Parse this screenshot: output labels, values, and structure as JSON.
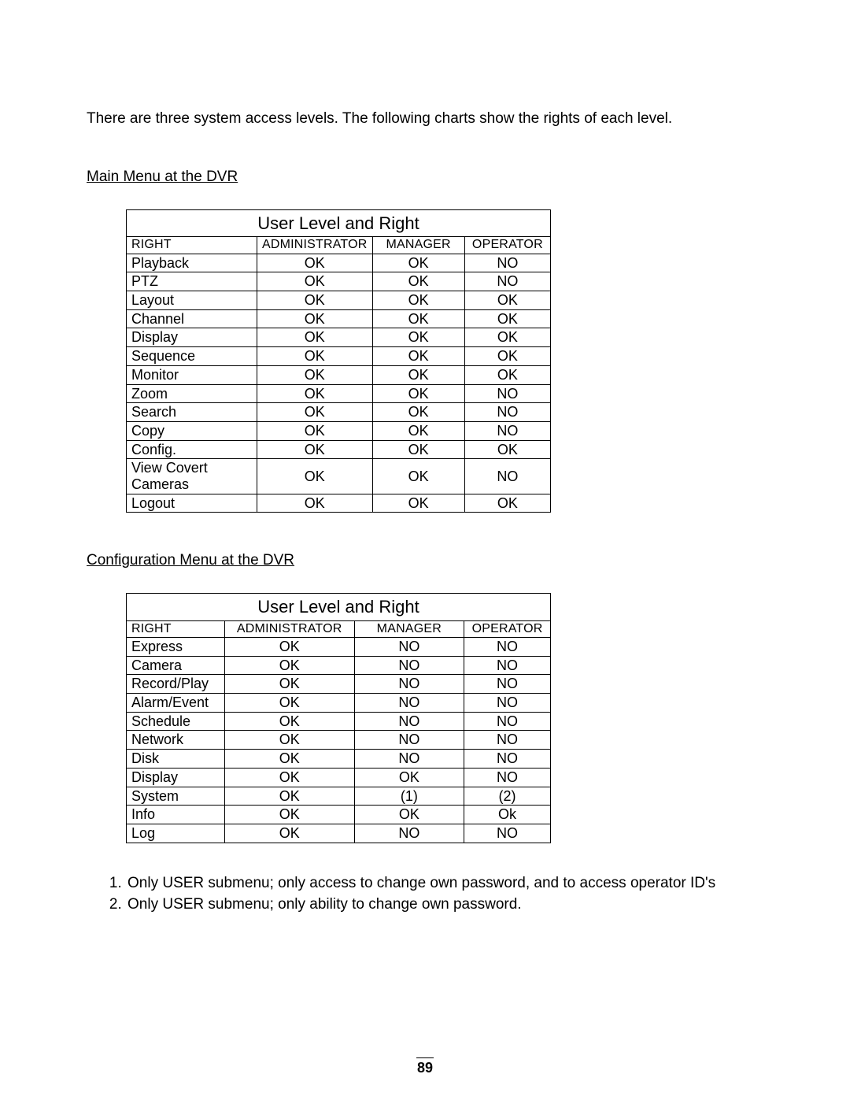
{
  "intro": "There are three system access levels. The following charts show the rights of each level.",
  "table1": {
    "heading": "Main Menu at the DVR",
    "title": "User Level and Right",
    "columns": [
      "RIGHT",
      "ADMINISTRATOR",
      "MANAGER",
      "OPERATOR"
    ],
    "rows": [
      {
        "label": "Playback",
        "admin": "OK",
        "manager": "OK",
        "operator": "NO"
      },
      {
        "label": "PTZ",
        "admin": "OK",
        "manager": "OK",
        "operator": "NO"
      },
      {
        "label": "Layout",
        "admin": "OK",
        "manager": "OK",
        "operator": "OK"
      },
      {
        "label": "Channel",
        "admin": "OK",
        "manager": "OK",
        "operator": "OK"
      },
      {
        "label": "Display",
        "admin": "OK",
        "manager": "OK",
        "operator": "OK"
      },
      {
        "label": "Sequence",
        "admin": "OK",
        "manager": "OK",
        "operator": "OK"
      },
      {
        "label": "Monitor",
        "admin": "OK",
        "manager": "OK",
        "operator": "OK"
      },
      {
        "label": "Zoom",
        "admin": "OK",
        "manager": "OK",
        "operator": "NO"
      },
      {
        "label": "Search",
        "admin": "OK",
        "manager": "OK",
        "operator": "NO"
      },
      {
        "label": "Copy",
        "admin": "OK",
        "manager": "OK",
        "operator": "NO"
      },
      {
        "label": "Config.",
        "admin": "OK",
        "manager": "OK",
        "operator": "OK"
      },
      {
        "label": "View Covert Cameras",
        "admin": "OK",
        "manager": "OK",
        "operator": "NO"
      },
      {
        "label": "Logout",
        "admin": "OK",
        "manager": "OK",
        "operator": "OK"
      }
    ]
  },
  "table2": {
    "heading": "Configuration Menu at the DVR",
    "title": "User Level and Right",
    "columns": [
      "RIGHT",
      "ADMINISTRATOR",
      "MANAGER",
      "OPERATOR"
    ],
    "rows": [
      {
        "label": "Express",
        "admin": "OK",
        "manager": "NO",
        "operator": "NO"
      },
      {
        "label": "Camera",
        "admin": "OK",
        "manager": "NO",
        "operator": "NO"
      },
      {
        "label": "Record/Play",
        "admin": "OK",
        "manager": "NO",
        "operator": "NO"
      },
      {
        "label": "Alarm/Event",
        "admin": "OK",
        "manager": "NO",
        "operator": "NO"
      },
      {
        "label": "Schedule",
        "admin": "OK",
        "manager": "NO",
        "operator": "NO"
      },
      {
        "label": "Network",
        "admin": "OK",
        "manager": "NO",
        "operator": "NO"
      },
      {
        "label": "Disk",
        "admin": "OK",
        "manager": "NO",
        "operator": "NO"
      },
      {
        "label": "Display",
        "admin": "OK",
        "manager": "OK",
        "operator": "NO"
      },
      {
        "label": "System",
        "admin": "OK",
        "manager": "(1)",
        "operator": "(2)"
      },
      {
        "label": "Info",
        "admin": "OK",
        "manager": "OK",
        "operator": "Ok"
      },
      {
        "label": "Log",
        "admin": "OK",
        "manager": "NO",
        "operator": "NO"
      }
    ]
  },
  "notes": [
    "Only USER submenu; only access to change own password, and to access operator ID's",
    "Only USER submenu; only ability to change own password."
  ],
  "page_number": "89"
}
